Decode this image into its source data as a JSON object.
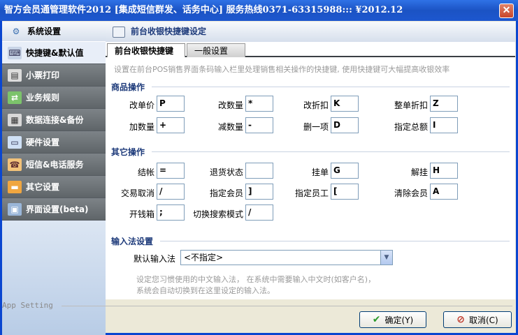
{
  "window": {
    "title": "智方会员通管理软件2012 [集成短信群发、话务中心] 服务热线0371-63315988::: ¥2012.12",
    "close_glyph": "✕"
  },
  "sidebar": {
    "header": "系统设置",
    "items": [
      {
        "label": "快捷键&默认值",
        "icon": "keyboard-icon"
      },
      {
        "label": "小票打印",
        "icon": "printer-icon"
      },
      {
        "label": "业务规则",
        "icon": "rules-icon"
      },
      {
        "label": "数据连接&备份",
        "icon": "database-icon"
      },
      {
        "label": "硬件设置",
        "icon": "monitor-icon"
      },
      {
        "label": "短信&电话服务",
        "icon": "phone-icon"
      },
      {
        "label": "其它设置",
        "icon": "folder-icon"
      },
      {
        "label": "界面设置(beta)",
        "icon": "display-icon"
      }
    ]
  },
  "main": {
    "title": "前台收银快捷键设定",
    "tabs": [
      "前台收银快捷键",
      "一般设置"
    ],
    "hint": "设置在前台POS销售界面条码输入栏里处理销售相关操作的快捷键, 使用快捷键可大幅提高收银效率",
    "sections": {
      "product": "商品操作",
      "other": "其它操作",
      "input": "输入法设置"
    },
    "product_keys": [
      {
        "label": "改单价",
        "key": "P"
      },
      {
        "label": "改数量",
        "key": "*"
      },
      {
        "label": "改折扣",
        "key": "K"
      },
      {
        "label": "整单折扣",
        "key": "Z"
      },
      {
        "label": "加数量",
        "key": "+"
      },
      {
        "label": "减数量",
        "key": "-"
      },
      {
        "label": "删一项",
        "key": "D"
      },
      {
        "label": "指定总额",
        "key": "I"
      }
    ],
    "other_keys": [
      {
        "label": "结帐",
        "key": "="
      },
      {
        "label": "退货状态",
        "key": ""
      },
      {
        "label": "挂单",
        "key": "G"
      },
      {
        "label": "解挂",
        "key": "H"
      },
      {
        "label": "交易取消",
        "key": "/"
      },
      {
        "label": "指定会员",
        "key": "]"
      },
      {
        "label": "指定员工",
        "key": "["
      },
      {
        "label": "清除会员",
        "key": "A"
      },
      {
        "label": "开钱箱",
        "key": ";"
      },
      {
        "label": "切换搜索模式",
        "key": "/"
      }
    ],
    "input_method": {
      "label": "默认输入法",
      "value": "<不指定>",
      "note_line1": "设定您习惯使用的中文输入法，  在系统中需要输入中文时(如客户名)，",
      "note_line2": "系统会自动切换到在这里设定的输入法。"
    }
  },
  "footer": {
    "status": "App Setting",
    "ok_label": "确定(Y)",
    "cancel_label": "取消(C)"
  }
}
